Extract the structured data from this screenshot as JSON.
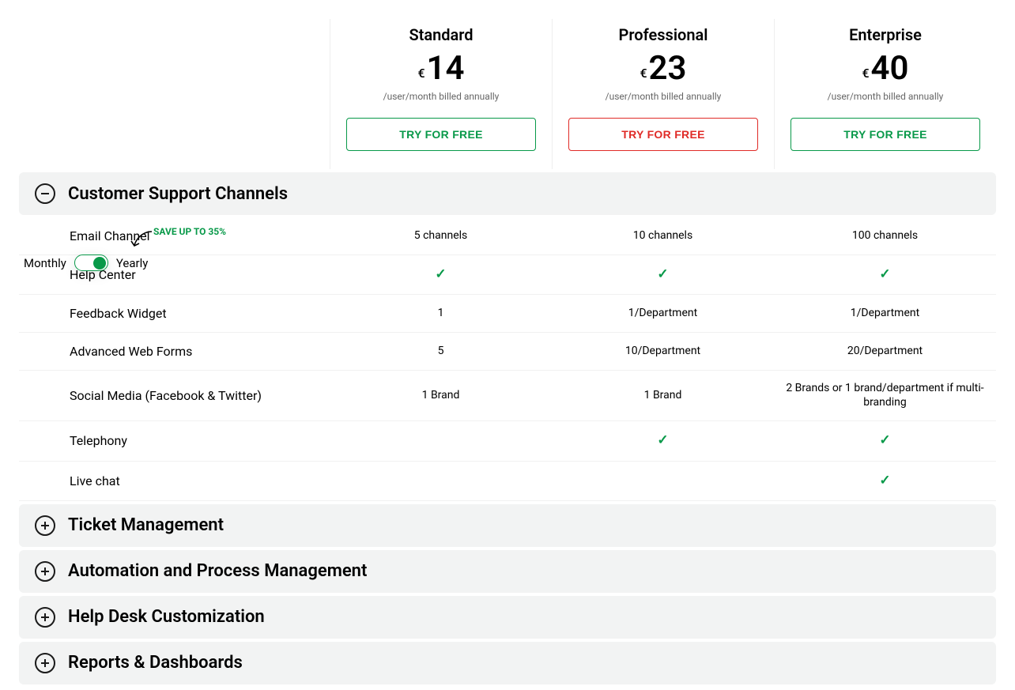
{
  "toggle": {
    "monthly_label": "Monthly",
    "yearly_label": "Yearly",
    "save_badge": "SAVE UP TO 35%",
    "state": "Yearly"
  },
  "plans": [
    {
      "name": "Standard",
      "currency": "€",
      "price": "14",
      "sub": "/user/month billed annually",
      "cta": "TRY FOR FREE",
      "cta_variant": "green"
    },
    {
      "name": "Professional",
      "currency": "€",
      "price": "23",
      "sub": "/user/month billed annually",
      "cta": "TRY FOR FREE",
      "cta_variant": "red"
    },
    {
      "name": "Enterprise",
      "currency": "€",
      "price": "40",
      "sub": "/user/month billed annually",
      "cta": "TRY FOR FREE",
      "cta_variant": "green"
    }
  ],
  "sections": [
    {
      "title": "Customer Support Channels",
      "expanded": true,
      "rows": [
        {
          "label": "Email Channel",
          "values": [
            "5 channels",
            "10 channels",
            "100 channels"
          ]
        },
        {
          "label": "Help Center",
          "values": [
            "check",
            "check",
            "check"
          ]
        },
        {
          "label": "Feedback Widget",
          "values": [
            "1",
            "1/Department",
            "1/Department"
          ]
        },
        {
          "label": "Advanced Web Forms",
          "values": [
            "5",
            "10/Department",
            "20/Department"
          ]
        },
        {
          "label": "Social Media (Facebook & Twitter)",
          "values": [
            "1 Brand",
            "1 Brand",
            "2 Brands or 1 brand/department if multi-branding"
          ]
        },
        {
          "label": "Telephony",
          "values": [
            "",
            "check",
            "check"
          ]
        },
        {
          "label": "Live chat",
          "values": [
            "",
            "",
            "check"
          ]
        }
      ]
    },
    {
      "title": "Ticket Management",
      "expanded": false
    },
    {
      "title": "Automation and Process Management",
      "expanded": false
    },
    {
      "title": "Help Desk Customization",
      "expanded": false
    },
    {
      "title": "Reports & Dashboards",
      "expanded": false
    }
  ],
  "icons": {
    "check": "✓"
  }
}
